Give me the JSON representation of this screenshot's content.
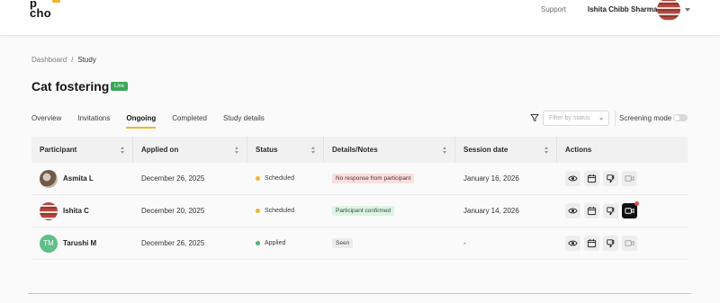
{
  "header": {
    "logo_line1": "p",
    "logo_line2": "cho",
    "support_label": "Support",
    "user_name": "Ishita Chibb Sharma",
    "accent": "#f2b431"
  },
  "breadcrumb": {
    "root": "Dashboard",
    "separator": "/",
    "current": "Study"
  },
  "page": {
    "title": "Cat fostering",
    "status_badge": "Live"
  },
  "tabs": [
    {
      "label": "Overview",
      "active": false
    },
    {
      "label": "Invitations",
      "active": false
    },
    {
      "label": "Ongoing",
      "active": true
    },
    {
      "label": "Completed",
      "active": false
    },
    {
      "label": "Study details",
      "active": false
    }
  ],
  "toolbar": {
    "filter_placeholder": "Filter by status",
    "screening_label": "Screening mode",
    "screening_on": false
  },
  "table": {
    "columns": [
      "Participant",
      "Applied on",
      "Status",
      "Details/Notes",
      "Session date",
      "Actions"
    ],
    "rows": [
      {
        "avatar": "photo",
        "name": "Asmita L",
        "applied_on": "December 26, 2025",
        "status": "Scheduled",
        "status_color": "#f2b431",
        "note": "No response from participant",
        "note_tone": "red",
        "session_date": "January 16, 2026",
        "actions": [
          "eye-icon",
          "calendar-icon",
          "thumbs-down-icon",
          "video-icon"
        ]
      },
      {
        "avatar": "photo",
        "name": "Ishita C",
        "applied_on": "December 20, 2025",
        "status": "Scheduled",
        "status_color": "#f2b431",
        "note": "Participant confirmed",
        "note_tone": "green",
        "session_date": "January 14, 2026",
        "actions": [
          "eye-icon",
          "calendar-icon",
          "thumbs-down-icon",
          "video-icon"
        ]
      },
      {
        "avatar": "initials",
        "initials": "TM",
        "name": "Tarushi M",
        "applied_on": "December 26, 2025",
        "status": "Applied",
        "status_color": "#4fb37a",
        "note": "Seen",
        "note_tone": "grey",
        "session_date": "-",
        "actions": [
          "eye-icon",
          "calendar-icon",
          "thumbs-down-icon",
          "video-icon"
        ]
      }
    ]
  }
}
